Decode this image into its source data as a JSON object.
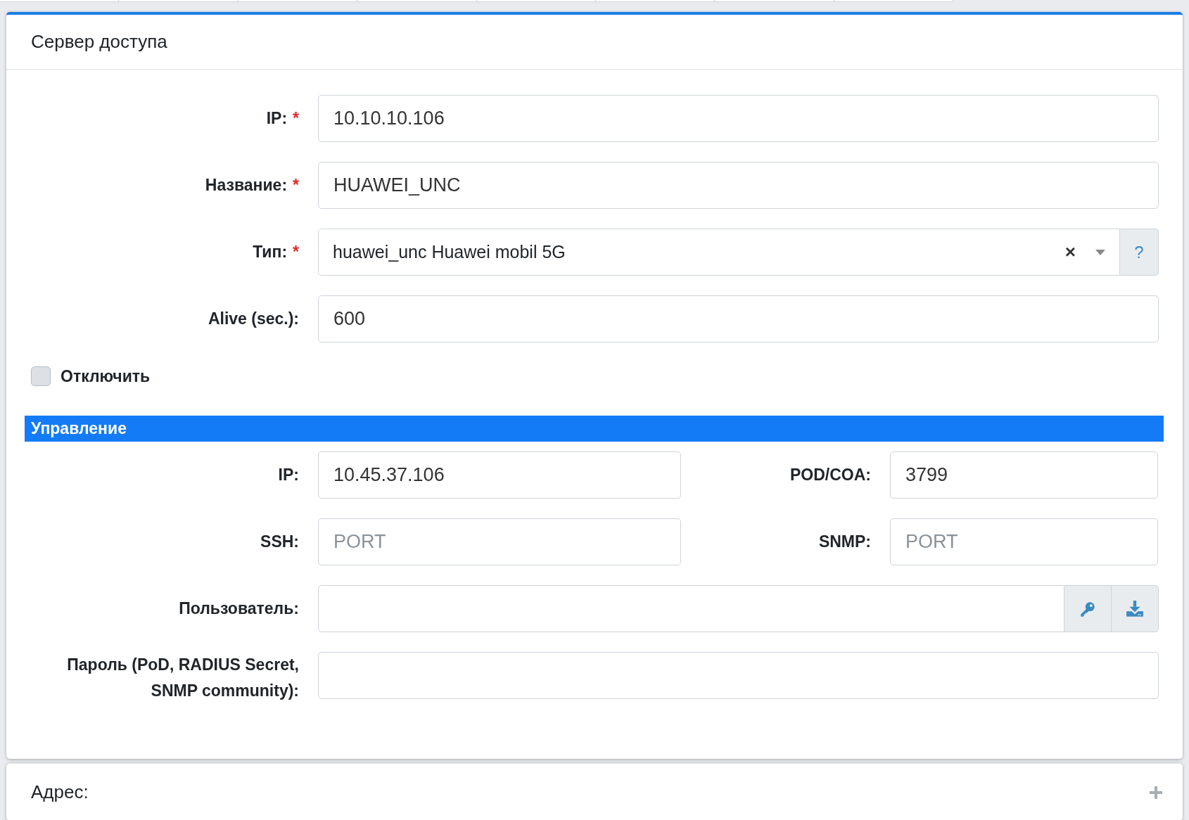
{
  "card": {
    "title": "Сервер доступа"
  },
  "fields": [
    {
      "label": "IP:",
      "required_mark": "*",
      "kind": "text",
      "value": "10.10.10.106"
    },
    {
      "label": "Название:",
      "required_mark": "*",
      "kind": "text",
      "value": "HUAWEI_UNC"
    },
    {
      "label": "Тип:",
      "required_mark": "*",
      "kind": "select",
      "value": "huawei_unc Huawei mobil 5G",
      "clear": "×",
      "help": "?"
    },
    {
      "label": "Alive (sec.):",
      "kind": "text",
      "value": "600"
    }
  ],
  "disable_checkbox": {
    "label": "Отключить",
    "checked": false
  },
  "management": {
    "title": "Управление",
    "rows": [
      [
        {
          "label": "IP:",
          "value": "10.45.37.106"
        },
        {
          "label": "POD/COA:",
          "value": "3799"
        }
      ],
      [
        {
          "label": "SSH:",
          "placeholder": "PORT"
        },
        {
          "label": "SNMP:",
          "placeholder": "PORT"
        }
      ]
    ],
    "user": {
      "label": "Пользователь:"
    },
    "password": {
      "label_lines": [
        "Пароль (PoD, RADIUS Secret,",
        "SNMP community):"
      ]
    }
  },
  "address_card": {
    "title": "Адрес:"
  }
}
